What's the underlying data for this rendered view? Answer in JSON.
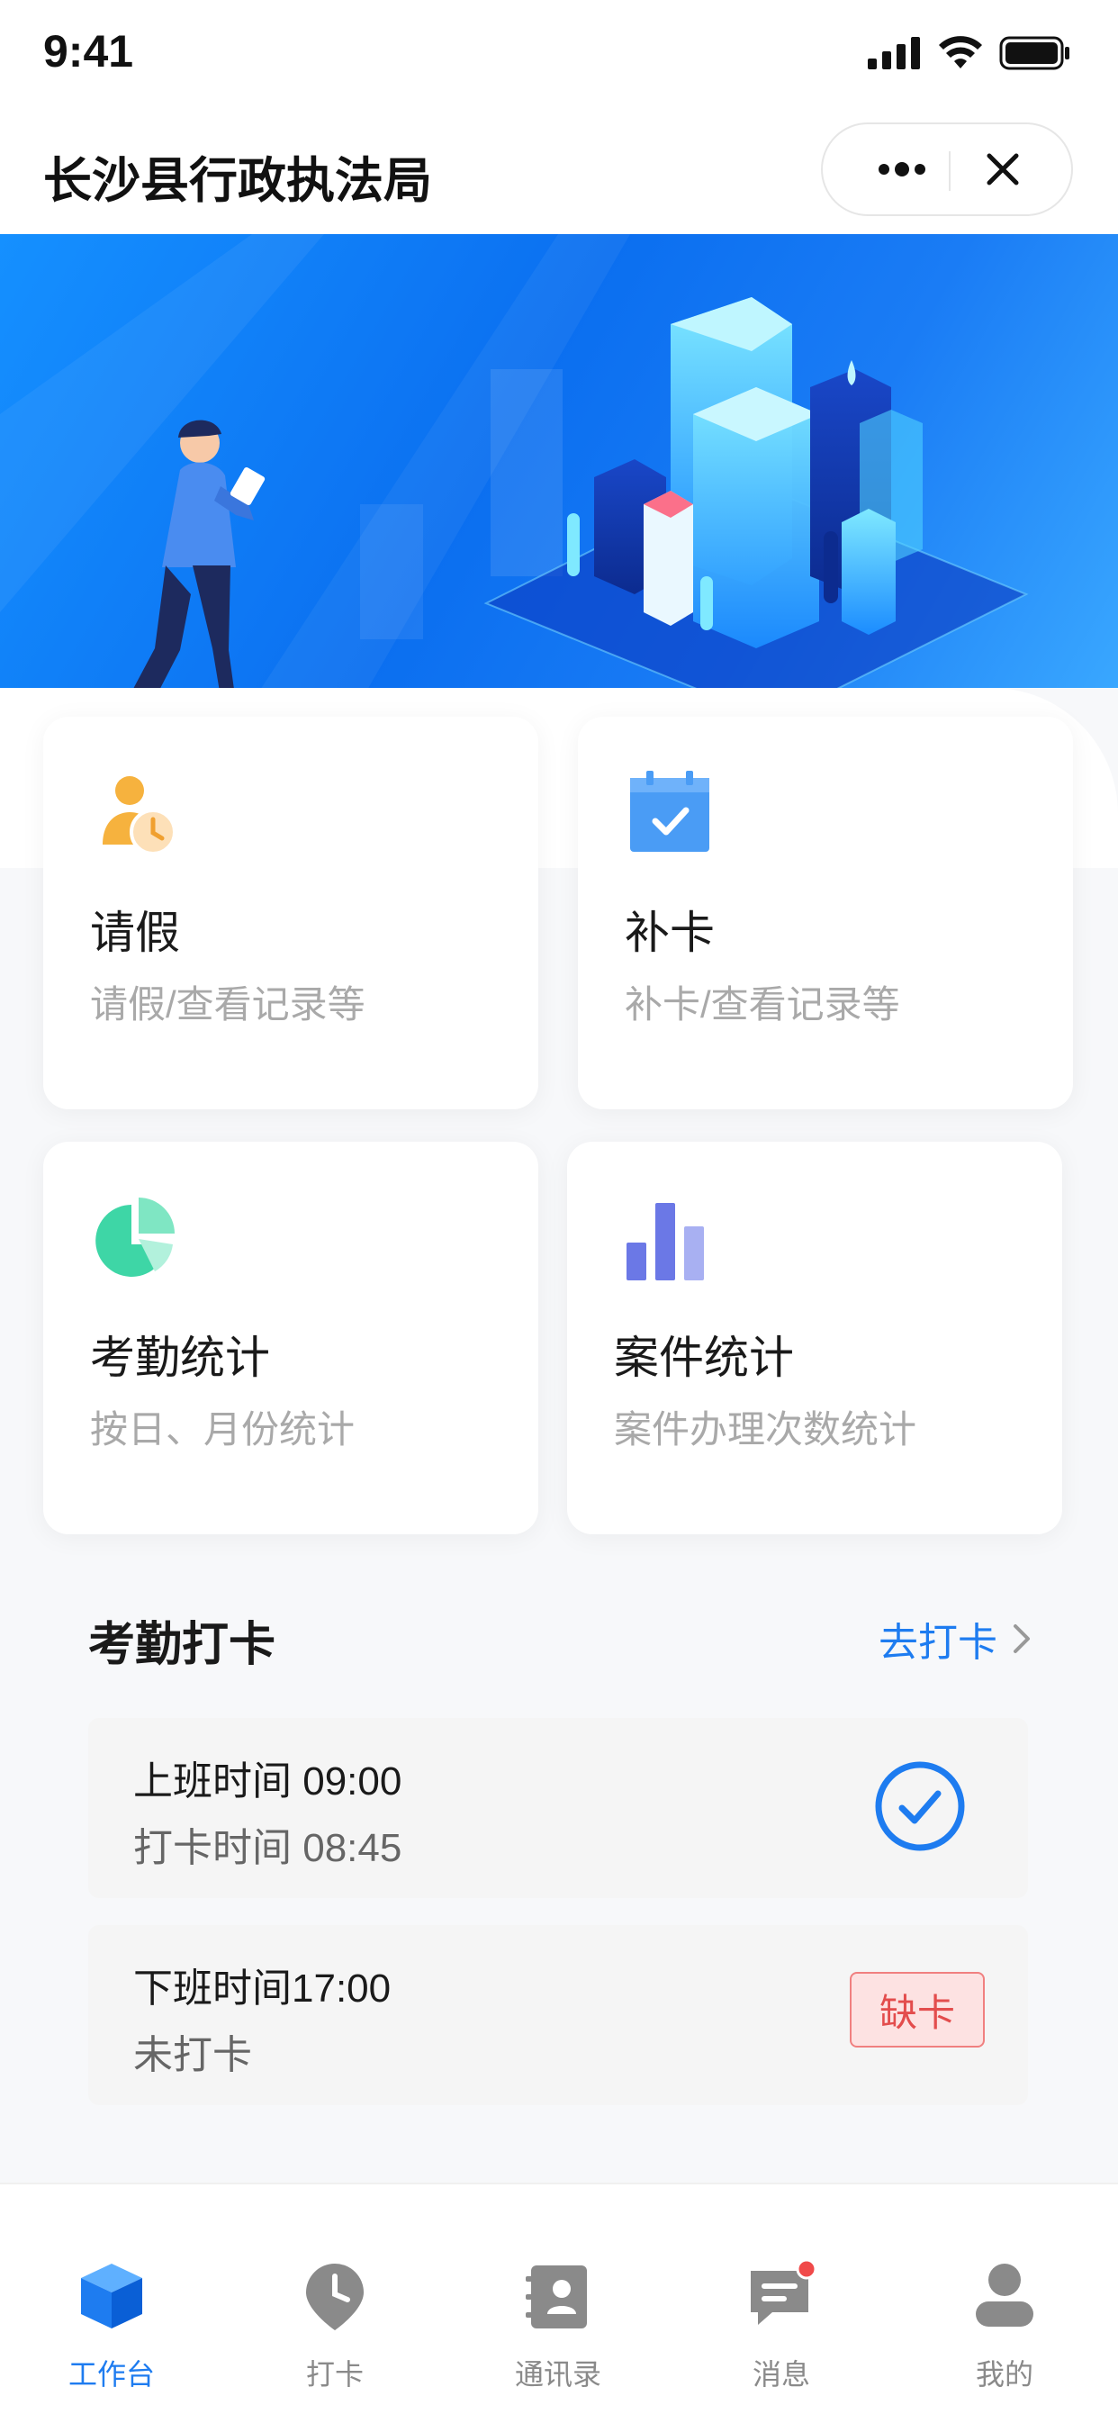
{
  "status_bar": {
    "time": "9:41"
  },
  "navbar": {
    "title": "长沙县行政执法局"
  },
  "cards": [
    {
      "title": "请假",
      "subtitle": "请假/查看记录等",
      "icon": "leave-person-clock-icon"
    },
    {
      "title": "补卡",
      "subtitle": "补卡/查看记录等",
      "icon": "calendar-check-icon"
    },
    {
      "title": "考勤统计",
      "subtitle": "按日、月份统计",
      "icon": "pie-chart-icon"
    },
    {
      "title": "案件统计",
      "subtitle": "案件办理次数统计",
      "icon": "bar-chart-icon"
    }
  ],
  "attendance": {
    "title": "考勤打卡",
    "link_label": "去打卡",
    "records": [
      {
        "shift": "上班时间 09:00",
        "status": "打卡时间 08:45",
        "state": "checked"
      },
      {
        "shift": "下班时间17:00",
        "status": "未打卡",
        "state": "missing",
        "badge": "缺卡"
      }
    ]
  },
  "tabbar": {
    "items": [
      {
        "label": "工作台",
        "icon": "cube-icon",
        "active": true
      },
      {
        "label": "打卡",
        "icon": "clock-pin-icon",
        "active": false
      },
      {
        "label": "通讯录",
        "icon": "contacts-book-icon",
        "active": false
      },
      {
        "label": "消息",
        "icon": "message-icon",
        "active": false,
        "badge_dot": true
      },
      {
        "label": "我的",
        "icon": "profile-icon",
        "active": false
      }
    ]
  },
  "colors": {
    "accent": "#1e7cf0",
    "missing": "#e34d4d",
    "muted": "#a9a9a9"
  }
}
